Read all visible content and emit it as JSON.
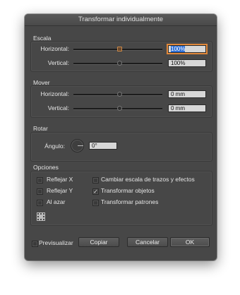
{
  "window": {
    "title": "Transformar individualmente"
  },
  "escala": {
    "legend": "Escala",
    "horizontal": {
      "label": "Horizontal:",
      "value": "100%"
    },
    "vertical": {
      "label": "Vertical:",
      "value": "100%"
    }
  },
  "mover": {
    "legend": "Mover",
    "horizontal": {
      "label": "Horizontal:",
      "value": "0 mm"
    },
    "vertical": {
      "label": "Vertical:",
      "value": "0 mm"
    }
  },
  "rotar": {
    "legend": "Rotar",
    "angle": {
      "label": "Ángulo:",
      "value": "0°"
    }
  },
  "opciones": {
    "legend": "Opciones",
    "reflejar_x": {
      "label": "Reflejar X",
      "checked": false
    },
    "reflejar_y": {
      "label": "Reflejar Y",
      "checked": false
    },
    "al_azar": {
      "label": "Al azar",
      "checked": false
    },
    "cambiar_escala": {
      "label": "Cambiar escala de trazos y efectos",
      "checked": false
    },
    "transformar_objetos": {
      "label": "Transformar objetos",
      "checked": true,
      "mark": "✓"
    },
    "transformar_patrones": {
      "label": "Transformar patrones",
      "checked": false
    }
  },
  "footer": {
    "preview": {
      "label": "Previsualizar",
      "checked": false
    },
    "copy": "Copiar",
    "cancel": "Cancelar",
    "ok": "OK"
  },
  "colors": {
    "window_bg": "#474747",
    "focus": "#e0883b",
    "selection": "#2f6fd6"
  }
}
